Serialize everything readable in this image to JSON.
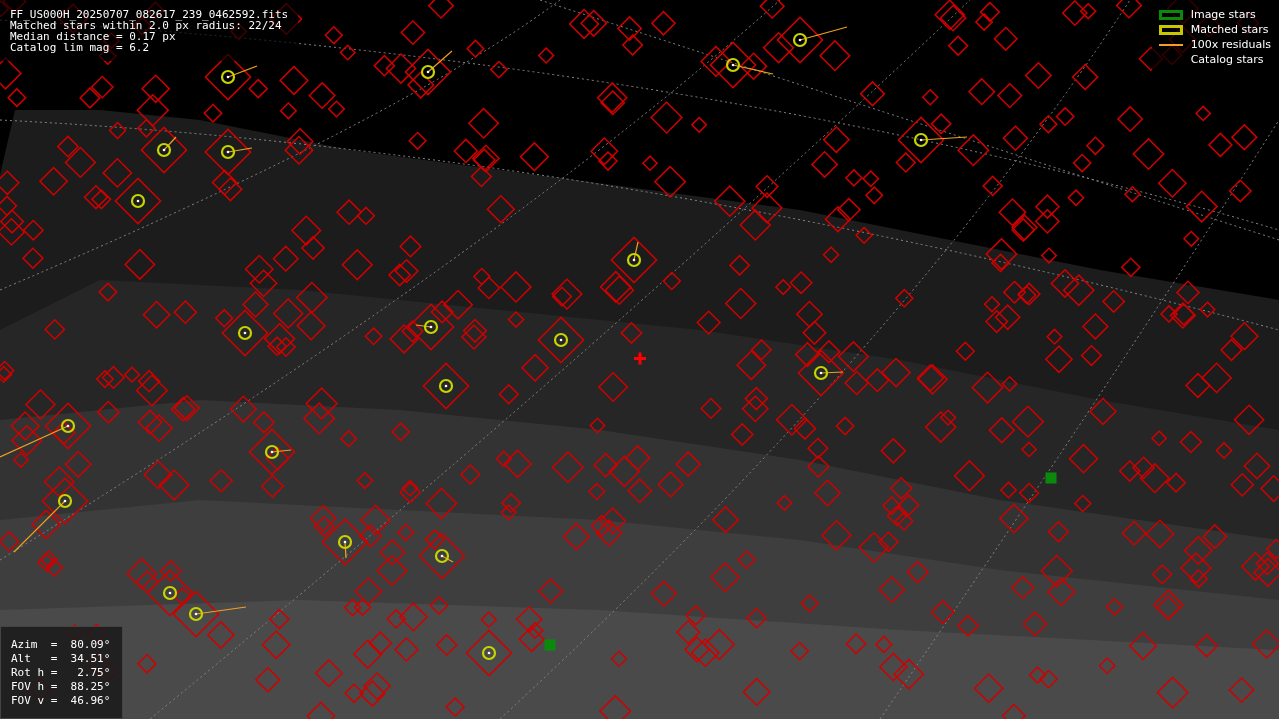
{
  "header": [
    "FF_US000H_20250707_082617_239_0462592.fits",
    "Matched stars within 2.0 px radius: 22/24",
    "Median distance = 0.17 px",
    "Catalog lim mag = 6.2"
  ],
  "legend": [
    {
      "kind": "image",
      "label": "Image stars"
    },
    {
      "kind": "matched",
      "label": "Matched stars"
    },
    {
      "kind": "residual",
      "label": "100x residuals"
    },
    {
      "kind": "catalog",
      "label": "Catalog stars"
    }
  ],
  "pointing": [
    "Azim  =  80.09°",
    "Alt   =  34.51°",
    "Rot h =   2.75°",
    "FOV h =  88.25°",
    "FOV v =  46.96°"
  ]
}
